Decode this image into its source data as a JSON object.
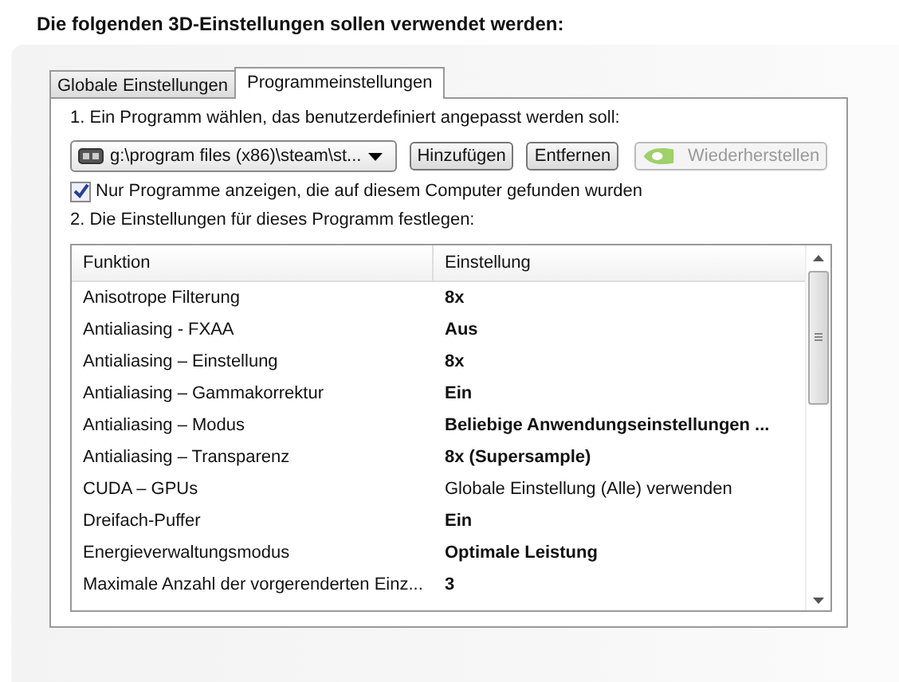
{
  "heading": "Die folgenden 3D-Einstellungen sollen verwendet werden:",
  "tabs": [
    {
      "label": "Globale Einstellungen",
      "selected": false
    },
    {
      "label": "Programmeinstellungen",
      "selected": true
    }
  ],
  "step1": "1. Ein Programm wählen, das benutzerdefiniert angepasst werden soll:",
  "program_select": {
    "value": "g:\\program files (x86)\\steam\\st..."
  },
  "buttons": [
    {
      "label": "Hinzufügen",
      "disabled": false,
      "kind": "plain"
    },
    {
      "label": "Entfernen",
      "disabled": false,
      "kind": "plain"
    },
    {
      "label": "Wiederherstellen",
      "disabled": true,
      "kind": "logo"
    }
  ],
  "filter_checkbox": {
    "label": "Nur Programme anzeigen, die auf diesem Computer gefunden wurden",
    "checked": true
  },
  "step2": "2. Die Einstellungen für dieses Programm festlegen:",
  "table": {
    "columns": [
      "Funktion",
      "Einstellung"
    ],
    "rows": [
      {
        "function": "Anisotrope Filterung",
        "setting": "8x",
        "modified": true
      },
      {
        "function": "Antialiasing - FXAA",
        "setting": "Aus",
        "modified": true
      },
      {
        "function": "Antialiasing – Einstellung",
        "setting": "8x",
        "modified": true
      },
      {
        "function": "Antialiasing – Gammakorrektur",
        "setting": "Ein",
        "modified": true
      },
      {
        "function": "Antialiasing – Modus",
        "setting": "Beliebige Anwendungseinstellungen ...",
        "modified": true
      },
      {
        "function": "Antialiasing – Transparenz",
        "setting": "8x (Supersample)",
        "modified": true
      },
      {
        "function": "CUDA – GPUs",
        "setting": "Globale Einstellung (Alle) verwenden",
        "modified": false
      },
      {
        "function": "Dreifach-Puffer",
        "setting": "Ein",
        "modified": true
      },
      {
        "function": "Energieverwaltungsmodus",
        "setting": "Optimale Leistung",
        "modified": true
      },
      {
        "function": "Maximale Anzahl der vorgerenderten Einz...",
        "setting": "3",
        "modified": true
      }
    ]
  }
}
